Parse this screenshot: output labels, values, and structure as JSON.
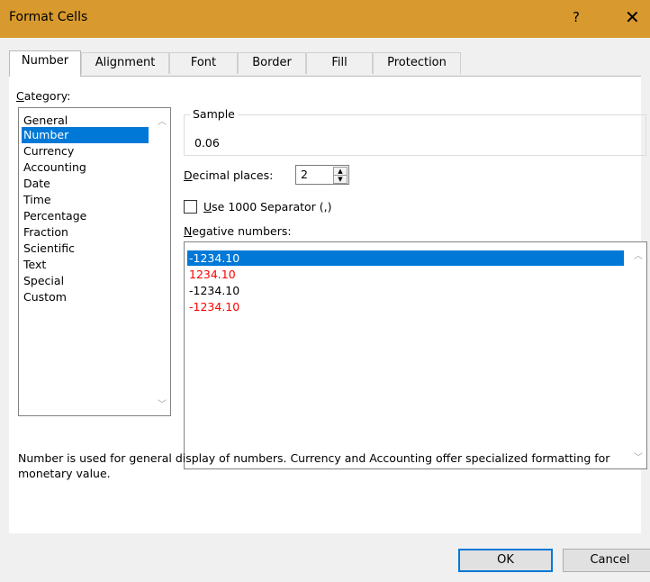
{
  "window": {
    "title": "Format Cells",
    "help_glyph": "?",
    "close_glyph": "✕"
  },
  "tabs": [
    {
      "label": "Number",
      "active": true
    },
    {
      "label": "Alignment",
      "active": false
    },
    {
      "label": "Font",
      "active": false
    },
    {
      "label": "Border",
      "active": false
    },
    {
      "label": "Fill",
      "active": false
    },
    {
      "label": "Protection",
      "active": false
    }
  ],
  "category": {
    "label_accel": "C",
    "label_rest": "ategory:",
    "items": [
      "General",
      "Number",
      "Currency",
      "Accounting",
      "Date",
      "Time",
      "Percentage",
      "Fraction",
      "Scientific",
      "Text",
      "Special",
      "Custom"
    ],
    "selected": "Number"
  },
  "sample": {
    "label": "Sample",
    "value": "0.06"
  },
  "decimal_places": {
    "label_accel": "D",
    "label_rest": "ecimal places:",
    "value": "2"
  },
  "separator": {
    "label_accel": "U",
    "label_rest": "se 1000 Separator (,)",
    "checked": false
  },
  "negative_numbers": {
    "label_accel": "N",
    "label_rest": "egative numbers:",
    "items": [
      {
        "text": "-1234.10",
        "color": "#000000",
        "selected": true
      },
      {
        "text": "1234.10",
        "color": "#ff0000",
        "selected": false
      },
      {
        "text": "-1234.10",
        "color": "#000000",
        "selected": false
      },
      {
        "text": "-1234.10",
        "color": "#ff0000",
        "selected": false
      }
    ]
  },
  "description": "Number is used for general display of numbers.  Currency and Accounting offer specialized formatting for monetary value.",
  "buttons": {
    "ok": "OK",
    "cancel": "Cancel"
  },
  "colors": {
    "titlebar": "#d89a2e",
    "selection": "#0078d7",
    "negative_red": "#ff0000"
  }
}
